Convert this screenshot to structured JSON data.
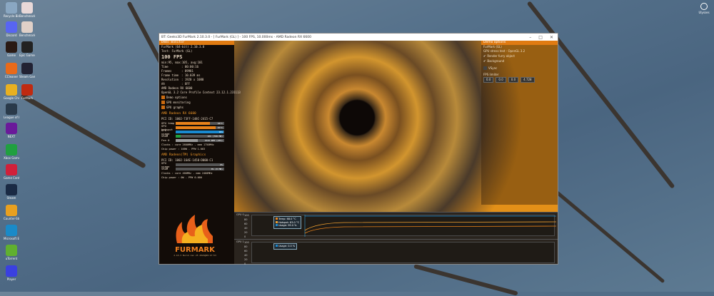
{
  "desktop": {
    "icons": [
      {
        "label": "Recycle Bin",
        "color": "#8aa7c2"
      },
      {
        "label": "Benchmark",
        "color": "#e8d8d8"
      },
      {
        "label": "Discord",
        "color": "#5865f2"
      },
      {
        "label": "Benchmark",
        "color": "#e0d0c8"
      },
      {
        "label": "Game",
        "color": "#2a1a14"
      },
      {
        "label": "Epic Games Launcher",
        "color": "#222"
      },
      {
        "label": "CCleaner",
        "color": "#e86a1a"
      },
      {
        "label": "Steam Game",
        "color": "#223"
      },
      {
        "label": "Google Chrome",
        "color": "#e8b020"
      },
      {
        "label": "FurMark",
        "color": "#c02a10"
      },
      {
        "label": "League of Legends",
        "color": "#2a3a4a"
      },
      {
        "label": "NEXT",
        "color": "#6a1a9a"
      },
      {
        "label": "Xbox Game",
        "color": "#20a040"
      },
      {
        "label": "Game Center",
        "color": "#d0203a"
      },
      {
        "label": "Steam",
        "color": "#1a2a44"
      },
      {
        "label": "Counter-Strike",
        "color": "#e8a020"
      },
      {
        "label": "Microsoft Edge",
        "color": "#1a8ac8"
      },
      {
        "label": "uTorrent",
        "color": "#60b030"
      },
      {
        "label": "Player",
        "color": "#3a40e0"
      }
    ],
    "top_right_label": "Ulysses"
  },
  "window": {
    "title": "BT: Geeks3D FurMark 2.10.3.0 - [ FurMark (GL) ] - 100 FPS, 10.000ms - AMD Radeon RX 6600",
    "min": "–",
    "max": "□",
    "close": "✕"
  },
  "left": {
    "header": "Demo monitor",
    "app": "FurMark (64-bit) 2.10.3.0",
    "test": "Test: FurMark (GL)",
    "fps": "100 FPS",
    "fps_stats": "min:95, max:105, avg:101",
    "stats": [
      [
        "Time",
        ": 00:00:16"
      ],
      [
        "Frames",
        ": 89981"
      ],
      [
        "Frame time",
        ": 10.039 ms"
      ],
      [
        "Resolution",
        ": 1920 x 1080"
      ],
      [
        "AA",
        ": OFF"
      ]
    ],
    "gpu_name": "AMD Radeon RX 6600",
    "gl": "OpenGL 3.2 Core Profile Context 23.12.1.231113",
    "checks": [
      "Demo options",
      "GPU monitoring",
      "GPU graphs"
    ],
    "gpu1": {
      "title": "AMD Radeon RX 6600",
      "pci": "PCI ID: 1002-73FF-148C-2415-C7",
      "bars": [
        {
          "k": "GPU temp",
          "v": "68°C",
          "pct": 70,
          "c": "#e8821a"
        },
        {
          "k": "GPU hotspot",
          "v": "83°C",
          "pct": 82,
          "c": "#e8821a"
        },
        {
          "k": "GPU usage",
          "v": "99%",
          "pct": 99,
          "c": "#1a8ad0"
        },
        {
          "k": "VRAM",
          "v": "10% (768 MB)",
          "pct": 10,
          "c": "#20a040"
        },
        {
          "k": "Fan 0",
          "v": "1644 RPM (45%)",
          "pct": 45,
          "c": "#999"
        }
      ],
      "clocks": "Clocks : core 2600MHz - mem 1750MHz",
      "power": "Chip power : 100W - PPW 1.003"
    },
    "gpu2": {
      "title": "AMD Radeon(TM) Graphics",
      "pci": "PCI ID: 1002-164E-1458-D000-C1",
      "bars": [
        {
          "k": "GPU usage",
          "v": "0%",
          "pct": 0,
          "c": "#1a8ad0"
        },
        {
          "k": "VRAM",
          "v": "0% (0 MB)",
          "pct": 0,
          "c": "#20a040"
        }
      ],
      "clocks": "Clocks : core 400MHz - mem 2400MHz",
      "power": "Chip power : 0W - PPW 0.000"
    },
    "logo_text": "FURMARK",
    "logo_sub": "2.10.3 Build Jan 25 2024@09:47:53"
  },
  "right": {
    "header": "Demo options",
    "l1": "FurMark (GL)",
    "l2": "GPU stress test - OpenGL 3.2",
    "checks": [
      "Render furry object",
      "Background"
    ],
    "vsync": "VSync",
    "fps_limiter": "FPS limiter",
    "spins": [
      "0.0",
      "0.0",
      "0.0",
      "4.728"
    ]
  },
  "graphs": [
    {
      "label": "GPU 0",
      "ticks": [
        "100",
        "80",
        "60",
        "40",
        "20",
        "0"
      ],
      "legend": [
        {
          "t": "Temp: 68.0 °C",
          "c": "#e8821a"
        },
        {
          "t": "Hotspot: 83.0 °C",
          "c": "#f0a030"
        },
        {
          "t": "Usage: 99.0 %",
          "c": "#1a8ad0"
        }
      ]
    },
    {
      "label": "GPU 1",
      "ticks": [
        "100",
        "80",
        "60",
        "40",
        "20",
        "0"
      ],
      "legend": [
        {
          "t": "Usage: 0.0 %",
          "c": "#1a8ad0"
        }
      ]
    }
  ]
}
